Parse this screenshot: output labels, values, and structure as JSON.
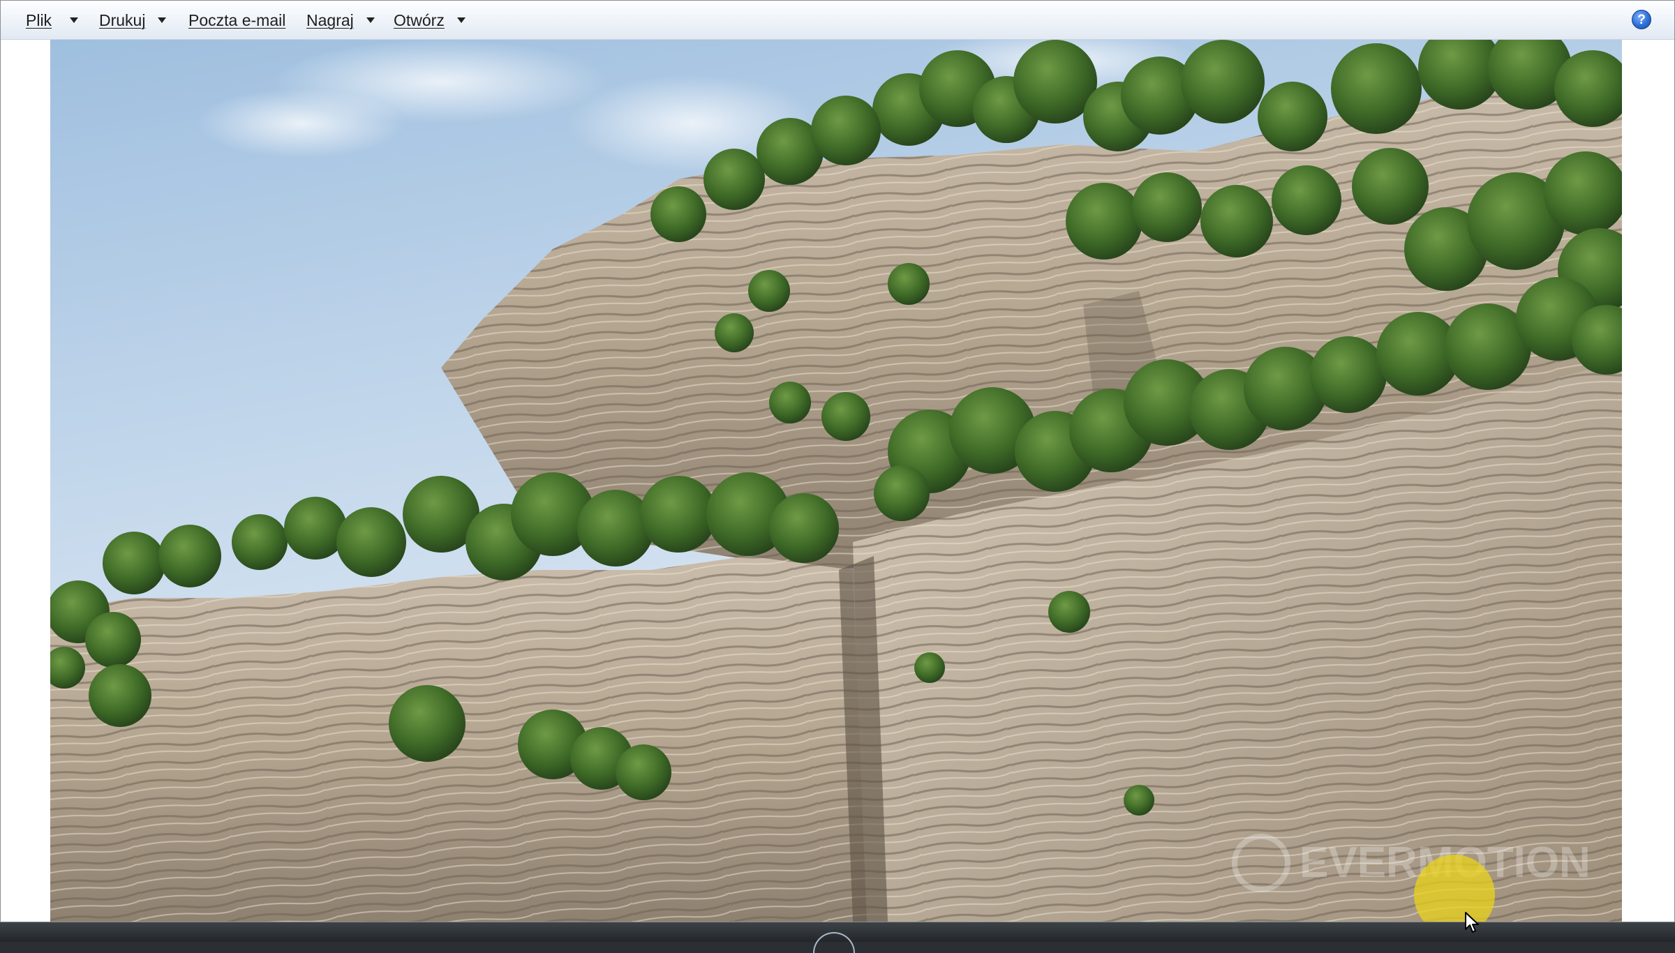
{
  "toolbar": {
    "file_label": "Plik",
    "print_label": "Drukuj",
    "email_label": "Poczta e-mail",
    "burn_label": "Nagraj",
    "open_label": "Otwórz",
    "help_label": "?"
  },
  "image": {
    "watermark": "EVERMOTION"
  },
  "icons": {
    "dropdown": "chevron-down-icon",
    "help": "help-icon",
    "cursor": "mouse-cursor-icon"
  },
  "colors": {
    "toolbar_bg": "#eef3f9",
    "help_blue": "#2d6fd6",
    "sky": "#bcd3ea",
    "rock": "#b8a994",
    "foliage": "#3f6b2a"
  }
}
